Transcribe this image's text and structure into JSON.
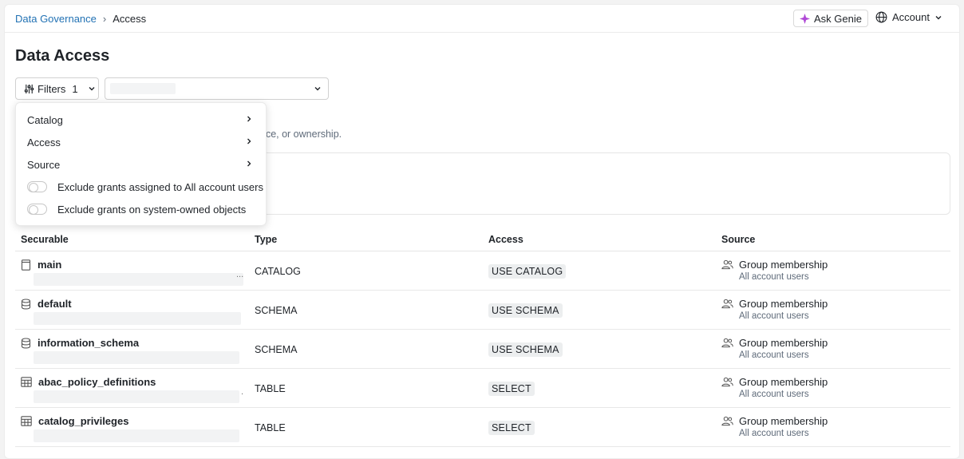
{
  "breadcrumb": {
    "parent": "Data Governance",
    "separator": "›",
    "current": "Access"
  },
  "header": {
    "ask_genie": "Ask Genie",
    "account": "Account"
  },
  "page": {
    "title": "Data Access",
    "description_partial": "nce, or ownership."
  },
  "filters": {
    "label": "Filters",
    "count": "1"
  },
  "dropdown": {
    "items": [
      "Catalog",
      "Access",
      "Source"
    ],
    "toggles": [
      "Exclude grants assigned to All account users",
      "Exclude grants on system-owned objects"
    ]
  },
  "table": {
    "headers": {
      "securable": "Securable",
      "type": "Type",
      "access": "Access",
      "source": "Source"
    },
    "rows": [
      {
        "name": "main",
        "icon": "catalog-icon",
        "type": "CATALOG",
        "access": "USE CATALOG",
        "source": "Group membership",
        "source_sub": "All account users",
        "ellipsis": "..."
      },
      {
        "name": "default",
        "icon": "schema-icon",
        "type": "SCHEMA",
        "access": "USE SCHEMA",
        "source": "Group membership",
        "source_sub": "All account users",
        "ellipsis": ""
      },
      {
        "name": "information_schema",
        "icon": "schema-icon",
        "type": "SCHEMA",
        "access": "USE SCHEMA",
        "source": "Group membership",
        "source_sub": "All account users",
        "ellipsis": ""
      },
      {
        "name": "abac_policy_definitions",
        "icon": "table-icon",
        "type": "TABLE",
        "access": "SELECT",
        "source": "Group membership",
        "source_sub": "All account users",
        "ellipsis": "."
      },
      {
        "name": "catalog_privileges",
        "icon": "table-icon",
        "type": "TABLE",
        "access": "SELECT",
        "source": "Group membership",
        "source_sub": "All account users",
        "ellipsis": ""
      }
    ]
  },
  "colors": {
    "link": "#2272b4",
    "genie_accent": "#b04ad6",
    "badge_bg": "#eceeef"
  }
}
